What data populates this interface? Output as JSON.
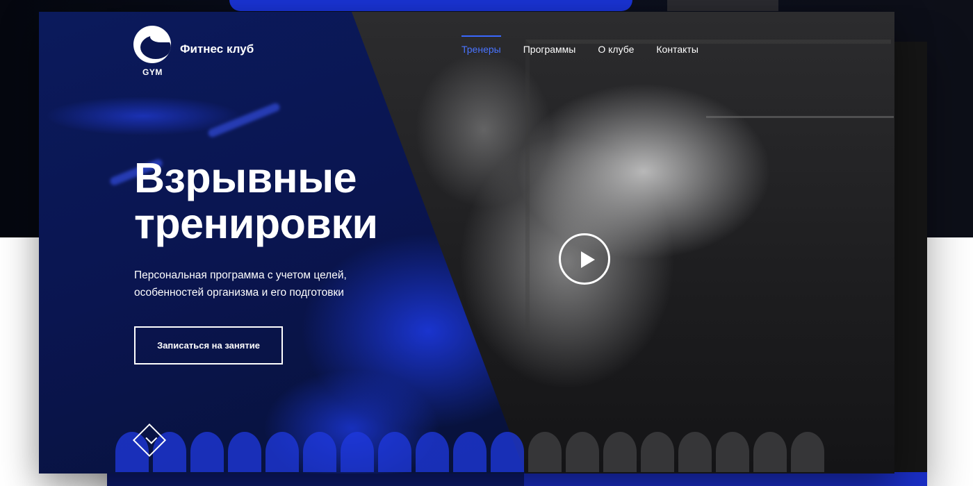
{
  "brand": {
    "logo_text": "GYM",
    "name": "Фитнес клуб"
  },
  "nav": {
    "items": [
      {
        "label": "Тренеры",
        "active": true
      },
      {
        "label": "Программы",
        "active": false
      },
      {
        "label": "О клубе",
        "active": false
      },
      {
        "label": "Контакты",
        "active": false
      }
    ]
  },
  "hero": {
    "title_line1": "Взрывные",
    "title_line2": "тренировки",
    "subtitle_line1": "Персональная программа с учетом целей,",
    "subtitle_line2": "особенностей организма и его подготовки",
    "cta_label": "Записаться на занятие"
  },
  "icons": {
    "play": "play-icon",
    "scroll": "scroll-down-diamond-icon",
    "logo": "rhino-logo-icon"
  },
  "colors": {
    "accent": "#3a68ff",
    "brand_blue": "#1a34d6",
    "dark": "#1b1b1d",
    "text": "#ffffff"
  }
}
